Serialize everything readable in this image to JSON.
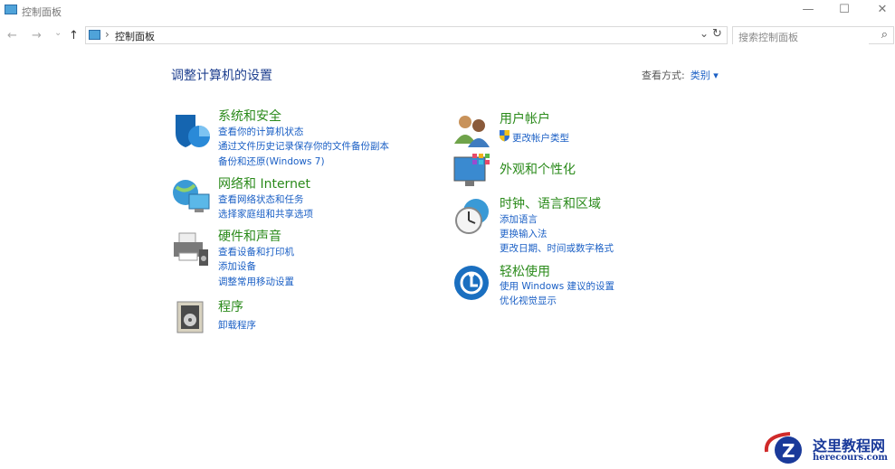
{
  "window": {
    "title": "控制面板",
    "minimize": "—",
    "maximize": "☐",
    "close": "✕"
  },
  "nav": {
    "back": "←",
    "forward": "→",
    "recent": "⌄",
    "up": "↑",
    "breadcrumb_sep": "›",
    "breadcrumb": "控制面板",
    "dropdown": "⌄",
    "refresh": "↻"
  },
  "search": {
    "placeholder": "搜索控制面板",
    "icon": "⌕"
  },
  "main": {
    "title": "调整计算机的设置",
    "view_by_label": "查看方式:",
    "view_by_value": "类别 ▾"
  },
  "categories": [
    {
      "heading": "系统和安全",
      "links": [
        "查看你的计算机状态",
        "通过文件历史记录保存你的文件备份副本",
        "备份和还原(Windows 7)"
      ]
    },
    {
      "heading": "网络和 Internet",
      "links": [
        "查看网络状态和任务",
        "选择家庭组和共享选项"
      ]
    },
    {
      "heading": "硬件和声音",
      "links": [
        "查看设备和打印机",
        "添加设备",
        "调整常用移动设置"
      ]
    },
    {
      "heading": "程序",
      "links": [
        "卸载程序"
      ]
    },
    {
      "heading": "用户帐户",
      "links": [
        "更改帐户类型"
      ]
    },
    {
      "heading": "外观和个性化",
      "links": []
    },
    {
      "heading": "时钟、语言和区域",
      "links": [
        "添加语言",
        "更换输入法",
        "更改日期、时间或数字格式"
      ]
    },
    {
      "heading": "轻松使用",
      "links": [
        "使用 Windows 建议的设置",
        "优化视觉显示"
      ]
    }
  ],
  "watermark": {
    "name": "这里教程网",
    "url": "herecours.com"
  }
}
